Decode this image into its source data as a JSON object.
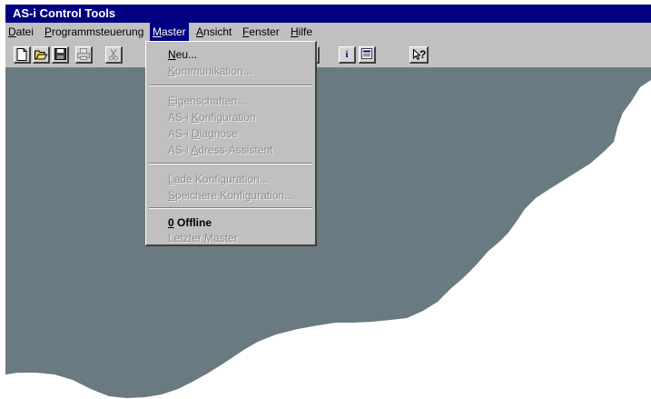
{
  "window": {
    "title": "AS-i Control Tools"
  },
  "menubar": [
    {
      "before": "",
      "accel": "D",
      "after": "atei"
    },
    {
      "before": "",
      "accel": "P",
      "after": "rogrammsteuerung"
    },
    {
      "before": "",
      "accel": "M",
      "after": "aster"
    },
    {
      "before": "",
      "accel": "A",
      "after": "nsicht"
    },
    {
      "before": "",
      "accel": "F",
      "after": "enster"
    },
    {
      "before": "",
      "accel": "H",
      "after": "ilfe"
    }
  ],
  "toolbar": {
    "icons": [
      "new-file-icon",
      "open-folder-icon",
      "save-disk-icon",
      "print-icon",
      "cut-scissors-icon",
      "info-icon",
      "properties-icon",
      "context-help-icon"
    ],
    "info_glyph": "i",
    "help_glyph": "?"
  },
  "master_menu": {
    "items": [
      {
        "before": "",
        "accel": "N",
        "after": "eu...",
        "enabled": true
      },
      {
        "before": "",
        "accel": "K",
        "after": "ommunikation...",
        "enabled": false
      },
      {
        "before": "",
        "accel": "E",
        "after": "igenschaften...",
        "enabled": false
      },
      {
        "before": "AS-i ",
        "accel": "K",
        "after": "onfiguration",
        "enabled": false
      },
      {
        "before": "AS-i ",
        "accel": "D",
        "after": "iagnose",
        "enabled": false
      },
      {
        "before": "AS-i ",
        "accel": "A",
        "after": "dress-Assistent",
        "enabled": false
      },
      {
        "before": "",
        "accel": "L",
        "after": "ade Konfiguration...",
        "enabled": false
      },
      {
        "before": "",
        "accel": "S",
        "after": "peichere Konfiguration...",
        "enabled": false
      },
      {
        "before": "",
        "accel": "0",
        "after": " Offline",
        "enabled": true
      },
      {
        "before": "",
        "accel": "",
        "after": "Letzter Master",
        "enabled": false
      }
    ]
  },
  "colors": {
    "titlebar": "#000080",
    "menu_bg": "#c0c0c0",
    "workspace": "#697a80",
    "disabled_text": "#8f8f8f"
  }
}
